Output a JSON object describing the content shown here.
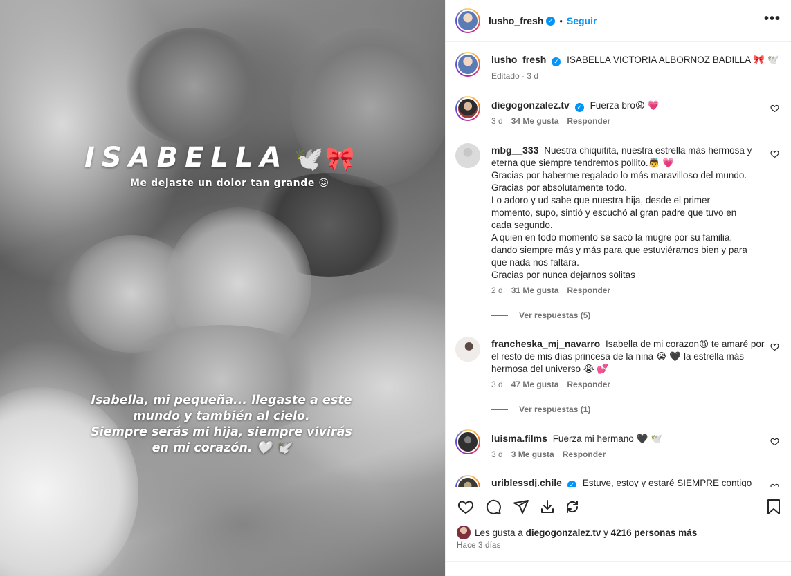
{
  "post": {
    "story_title": "ISABELLA",
    "story_subtitle": "Me dejaste un dolor tan grande 😖",
    "story_caption": [
      "Isabella, mi pequeña... llegaste a este",
      "mundo y también al cielo.",
      "Siempre serás mi hija, siempre vivirás",
      "en mi corazón. 🤍 🕊️"
    ],
    "title_emojis": [
      "🕊️",
      "🎀"
    ]
  },
  "header": {
    "username": "lusho_fresh",
    "separator": "•",
    "follow_label": "Seguir",
    "more_label": "•••"
  },
  "caption": {
    "username": "lusho_fresh",
    "text": "ISABELLA VICTORIA ALBORNOZ BADILLA 🎀 🕊️",
    "edited": "Editado · 3 d"
  },
  "comments": [
    {
      "username": "diegogonzalez.tv",
      "text": "Fuerza bro😩 💗",
      "age": "3 d",
      "likes": "34 Me gusta",
      "reply": "Responder"
    },
    {
      "username": "mbg__333",
      "text": "Nuestra chiquitita, nuestra estrella más hermosa y eterna que siempre tendremos pollito.👼 💗 Gracias por haberme regalado lo más maravilloso del mundo. Gracias por absolutamente todo. Lo adoro y ud sabe que nuestra hija, desde el primer momento, supo, sintió y escuchó al gran padre que tuvo en cada segundo. A quien en todo momento se sacó la mugre por su familia, dando siempre más y más para que estuviéramos bien y para que nada nos faltara. Gracias por nunca dejarnos solitas",
      "lines": [
        "Nuestra chiquitita, nuestra estrella más hermosa y",
        "eterna que siempre tendremos pollito.👼 💗",
        "Gracias por haberme regalado lo más maravilloso del mundo.",
        "Gracias por absolutamente todo.",
        "Lo adoro y ud sabe que nuestra hija, desde el primer",
        "momento, supo, sintió y escuchó al gran padre que tuvo en",
        "cada segundo.",
        "A quien en todo momento se sacó la mugre por su familia,",
        "dando siempre más y más para que estuviéramos bien y para",
        "que nada nos faltara.",
        "Gracias por nunca dejarnos solitas"
      ],
      "age": "2 d",
      "likes": "31 Me gusta",
      "reply": "Responder",
      "view_replies": "Ver respuestas (5)"
    },
    {
      "username": "francheska_mj_navarro",
      "lines": [
        "Isabella de mi corazon😩  te amaré por",
        "el resto de mis días princesa de la nina 😭 🖤 la estrella más",
        "hermosa del universo 😭 💕"
      ],
      "age": "3 d",
      "likes": "47 Me gusta",
      "reply": "Responder",
      "view_replies": "Ver respuestas (1)"
    },
    {
      "username": "luisma.films",
      "text": "Fuerza mi hermano 🖤 🕊️",
      "age": "3 d",
      "likes": "3 Me gusta",
      "reply": "Responder"
    },
    {
      "username": "uriblessdj.chile",
      "text": "Estuve, estoy y estaré SIEMPRE contigo"
    }
  ],
  "likes": {
    "prefix": "Les gusta a ",
    "user": "diegogonzalez.tv",
    "middle": " y ",
    "count": "4216 personas más"
  },
  "time_ago": "Hace 3 días",
  "icons": [
    "heart-icon",
    "comment-icon",
    "share-icon",
    "download-icon",
    "repost-icon",
    "bookmark-icon",
    "verified-icon"
  ],
  "colors": {
    "accent": "#0095f6",
    "text": "#262626",
    "muted": "#737373",
    "heart": "#ff3040"
  }
}
